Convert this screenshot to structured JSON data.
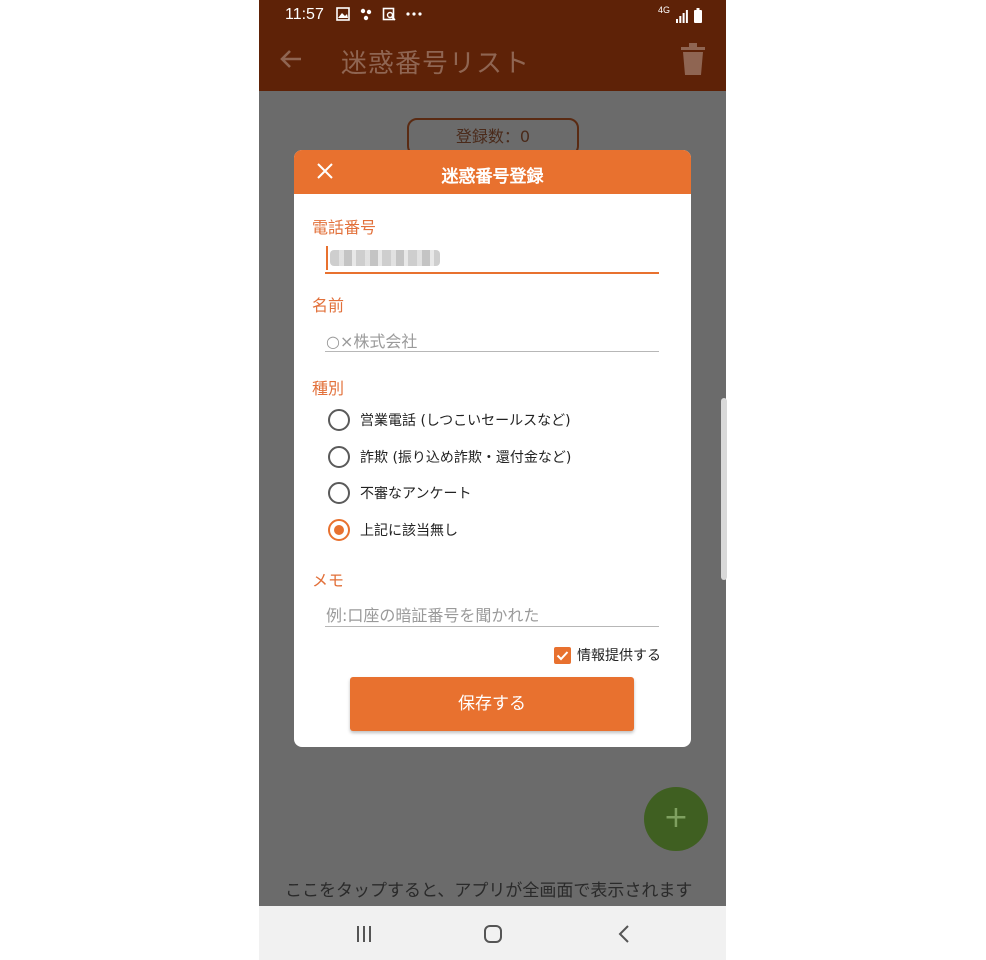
{
  "status_bar": {
    "time": "11:57",
    "network": "4G"
  },
  "app_bar": {
    "title": "迷惑番号リスト"
  },
  "background": {
    "count_label": "登録数：0",
    "fab_label": "+",
    "hint_text": "ここをタップすると、アプリが全画面で表示されます"
  },
  "dialog": {
    "title": "迷惑番号登録",
    "phone": {
      "label": "電話番号",
      "value": ""
    },
    "name": {
      "label": "名前",
      "placeholder": "○×株式会社"
    },
    "category": {
      "label": "種別",
      "options": [
        {
          "label": "営業電話 (しつこいセールスなど)",
          "selected": false
        },
        {
          "label": "詐欺 (振り込め詐欺・還付金など)",
          "selected": false
        },
        {
          "label": "不審なアンケート",
          "selected": false
        },
        {
          "label": "上記に該当無し",
          "selected": true
        }
      ]
    },
    "memo": {
      "label": "メモ",
      "placeholder": "例:口座の暗証番号を聞かれた"
    },
    "share": {
      "label": "情報提供する",
      "checked": true
    },
    "save_label": "保存する"
  },
  "colors": {
    "accent": "#e8712f",
    "appbar": "#5e2207",
    "scrim": "#6b6b6b",
    "fab": "#3f5f21"
  }
}
